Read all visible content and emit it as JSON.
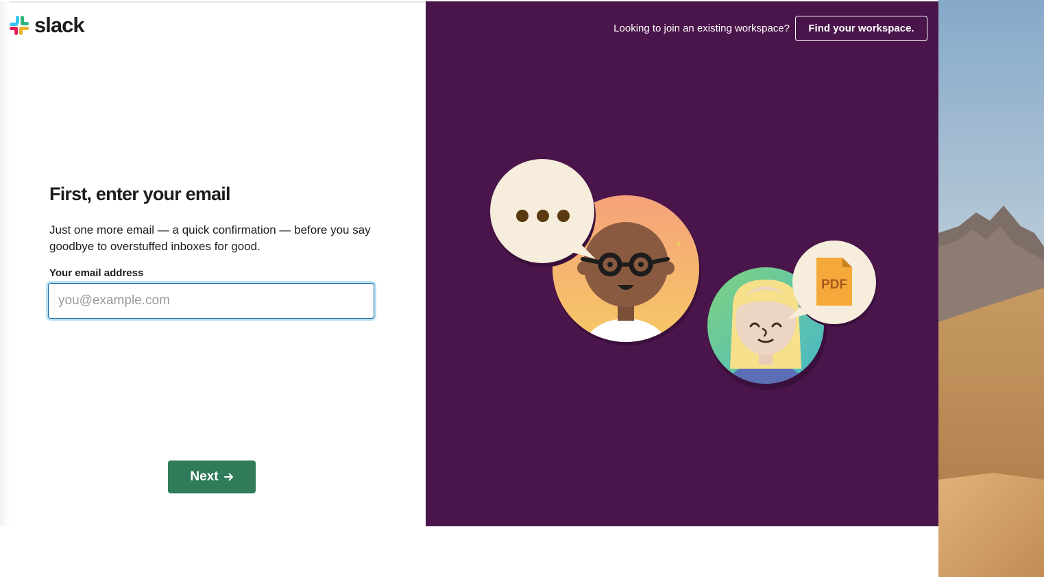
{
  "app": {
    "logo_text": "slack"
  },
  "signup": {
    "title": "First, enter your email",
    "description": "Just one more email — a quick confirmation — before you say goodbye to overstuffed inboxes for good.",
    "email_label": "Your email address",
    "email_placeholder": "you@example.com",
    "email_value": "",
    "next_label": "Next",
    "next_icon": "arrow-right-icon"
  },
  "header": {
    "join_prompt": "Looking to join an existing workspace?",
    "find_workspace_label": "Find your workspace."
  },
  "illustration": {
    "file_badge": "PDF"
  },
  "colors": {
    "brand_purple": "#4a154b",
    "next_button": "#2f7b5a",
    "focus_blue": "#1264a3"
  }
}
